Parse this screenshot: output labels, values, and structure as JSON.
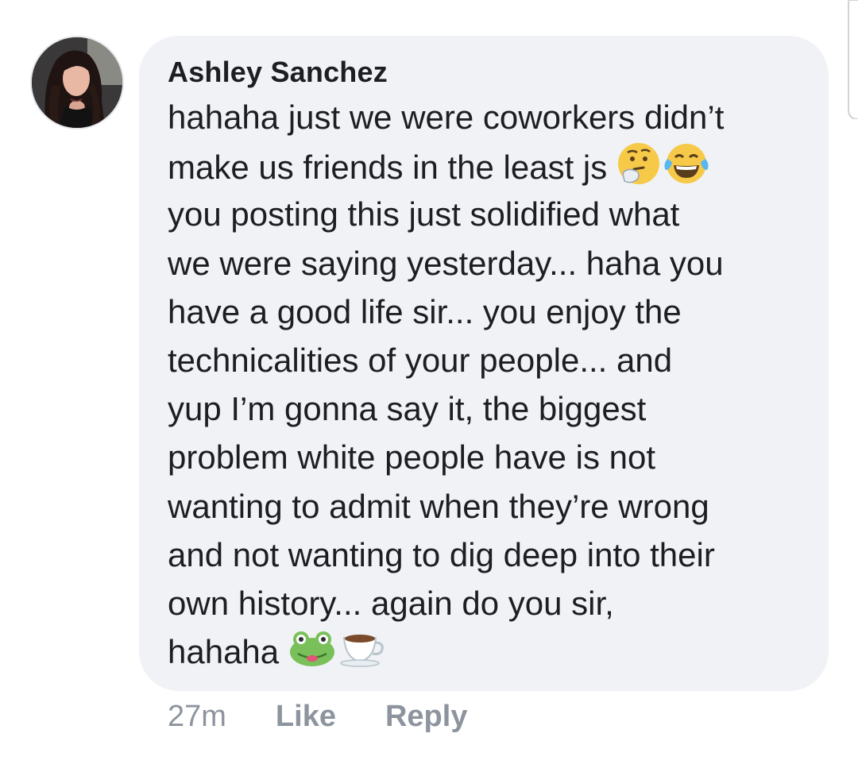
{
  "comment": {
    "author": "Ashley Sanchez",
    "lines": [
      "hahaha just we were coworkers didn’t",
      "make us friends in the least js",
      "you posting this just solidified what",
      "we were saying yesterday... haha you",
      "have a good life sir... you enjoy the",
      "technicalities of your people... and",
      "yup I’m gonna say it, the biggest",
      "problem white people have is not",
      "wanting to admit when they’re wrong",
      "and not wanting to dig deep into their",
      "own history... again do you sir,",
      "hahaha"
    ],
    "emojis": {
      "line_2": [
        "thinking-face",
        "tears-of-joy-face"
      ],
      "line_12": [
        "frog-face",
        "hot-beverage"
      ]
    }
  },
  "footer": {
    "time": "27m",
    "like_label": "Like",
    "reply_label": "Reply"
  },
  "colors": {
    "bubble_bg": "#f0f2f5",
    "text": "#1c1e21",
    "meta": "#8d949e"
  }
}
